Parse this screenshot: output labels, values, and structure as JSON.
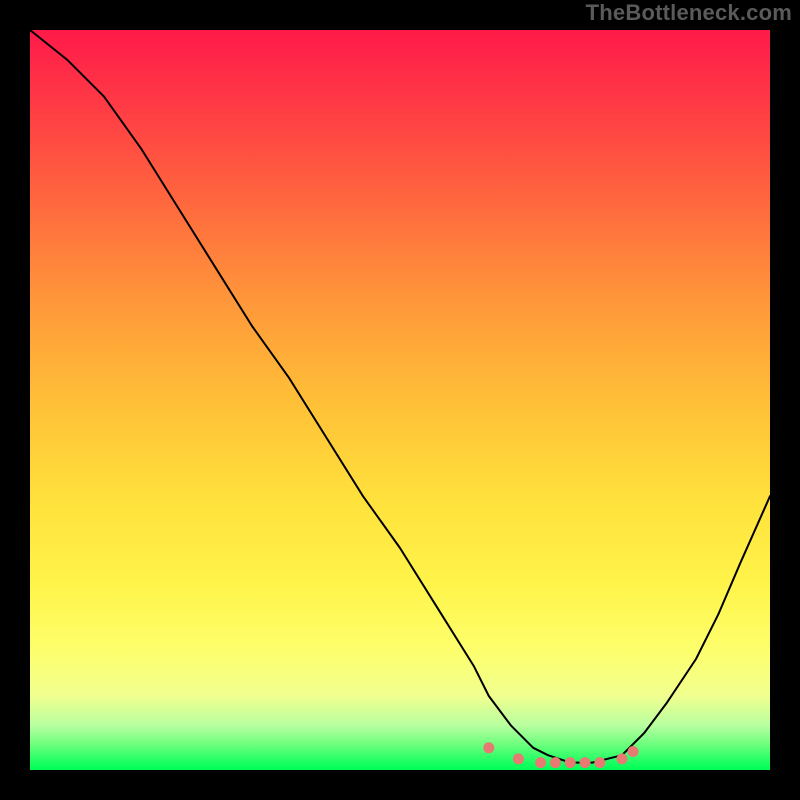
{
  "watermark": "TheBottleneck.com",
  "colors": {
    "background": "#000000",
    "gradient_stops": [
      "#ff1a49",
      "#ff3a45",
      "#ff6a3e",
      "#ff953a",
      "#ffbf37",
      "#ffe23c",
      "#fff44a",
      "#fdff6d",
      "#f0ff8f",
      "#b8ffa0",
      "#5eff77",
      "#19ff62",
      "#00ff54"
    ],
    "curve": "#000000",
    "marker": "#e77a72"
  },
  "chart_data": {
    "type": "line",
    "title": "",
    "xlabel": "",
    "ylabel": "",
    "xlim": [
      0,
      100
    ],
    "ylim": [
      0,
      100
    ],
    "grid": false,
    "legend": false,
    "series": [
      {
        "name": "bottleneck-curve",
        "x": [
          0,
          5,
          10,
          15,
          20,
          25,
          30,
          35,
          40,
          45,
          50,
          55,
          60,
          62,
          65,
          68,
          70,
          73,
          76,
          80,
          83,
          86,
          90,
          93,
          96,
          100
        ],
        "y": [
          100,
          96,
          91,
          84,
          76,
          68,
          60,
          53,
          45,
          37,
          30,
          22,
          14,
          10,
          6,
          3,
          2,
          1,
          1,
          2,
          5,
          9,
          15,
          21,
          28,
          37
        ]
      }
    ],
    "markers": {
      "name": "optimal-range",
      "x": [
        62,
        66,
        69,
        71,
        73,
        75,
        77,
        80,
        81.5
      ],
      "y": [
        3,
        1.5,
        1,
        1,
        1,
        1,
        1,
        1.5,
        2.5
      ]
    }
  }
}
